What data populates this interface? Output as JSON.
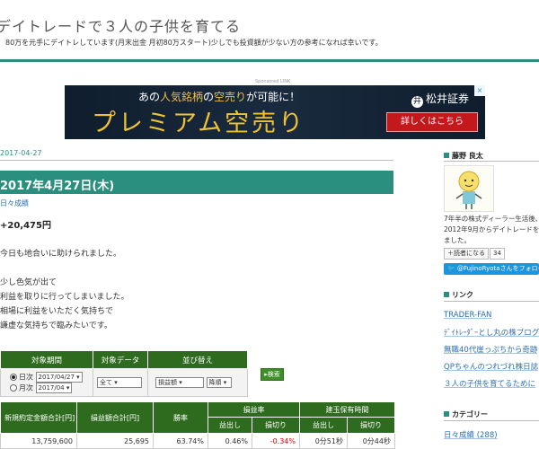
{
  "header": {
    "title": "デイトレードで３人の子供を育てる",
    "description": "80万を元手にデイトレしています(月末出金 月初80万スタート)少しでも投資額が少ない方の参考になれば幸いです。"
  },
  "ad": {
    "label": "Sponsored LINK",
    "top_text_pre": "あの",
    "top_text_hl": "人気銘柄",
    "top_text_mid": "の",
    "top_text_hl2": "空売り",
    "top_text_post": "が可能に！",
    "main_text": "プレミアム空売り",
    "logo_text": "松井証券",
    "logo_mark": "井",
    "button_label": "詳しくはこちら",
    "close_label": "×"
  },
  "post": {
    "date": "2017-04-27",
    "title": "2017年4月27日(木)",
    "category": "日々成績",
    "profit": "+20,475円",
    "lines": [
      "今日も地合いに助けられました。",
      "少し色気が出て",
      "利益を取りに行ってしまいました。",
      "相場に利益をいただく気持ちで",
      "謙虚な気持ちで臨みたいです。"
    ]
  },
  "search_form": {
    "headers": [
      "対象期間",
      "対象データ",
      "並び替え"
    ],
    "period_day_label": "日次",
    "period_day_value": "2017/04/27",
    "period_month_label": "月次",
    "period_month_value": "2017/04",
    "data_value": "全て",
    "sort_value": "損益額",
    "order_value": "降順",
    "search_button": "検索"
  },
  "stats": {
    "h_total": "新規約定金額合計[円]",
    "h_pl_total": "損益額合計[円]",
    "h_win_rate": "勝率",
    "h_pl_rate": "損益率",
    "h_hold_time": "建玉保有時間",
    "h_profit": "益出し",
    "h_loss": "損切り",
    "h_hold_profit": "益出し",
    "h_hold_loss": "損切り",
    "row": {
      "total": "13,759,600",
      "pl_total": "25,695",
      "win_rate": "63.74%",
      "profit_rate": "0.46%",
      "loss_rate": "-0.34%",
      "hold_profit": "0分51秒",
      "hold_loss": "0分44秒"
    }
  },
  "sidebar": {
    "profile_header": "藤野 良太",
    "profile_lines": [
      "7年半の株式ディーラー生活後、",
      "2012年9月からデイトレードを",
      "ました。"
    ],
    "reader_label": "＋読者になる",
    "reader_count": "34",
    "twitter_label": "@FujinoRyotaさんをフォロー",
    "links_header": "リンク",
    "links": [
      "TRADER-FAN",
      "ﾃﾞｲﾄﾚｰﾀﾞｰとし丸の株ブログ",
      "無職40代崖っぷちから奇跡",
      "QPちゃんのつれづれ株日誌",
      "３人の子供を育てるために"
    ],
    "category_header": "カテゴリー",
    "categories": [
      "日々成績 (288)"
    ]
  },
  "colors": {
    "accent": "#2b8f7f",
    "table_header": "#2e6b1f",
    "link": "#2a6fb5",
    "negative": "#dd0000"
  }
}
